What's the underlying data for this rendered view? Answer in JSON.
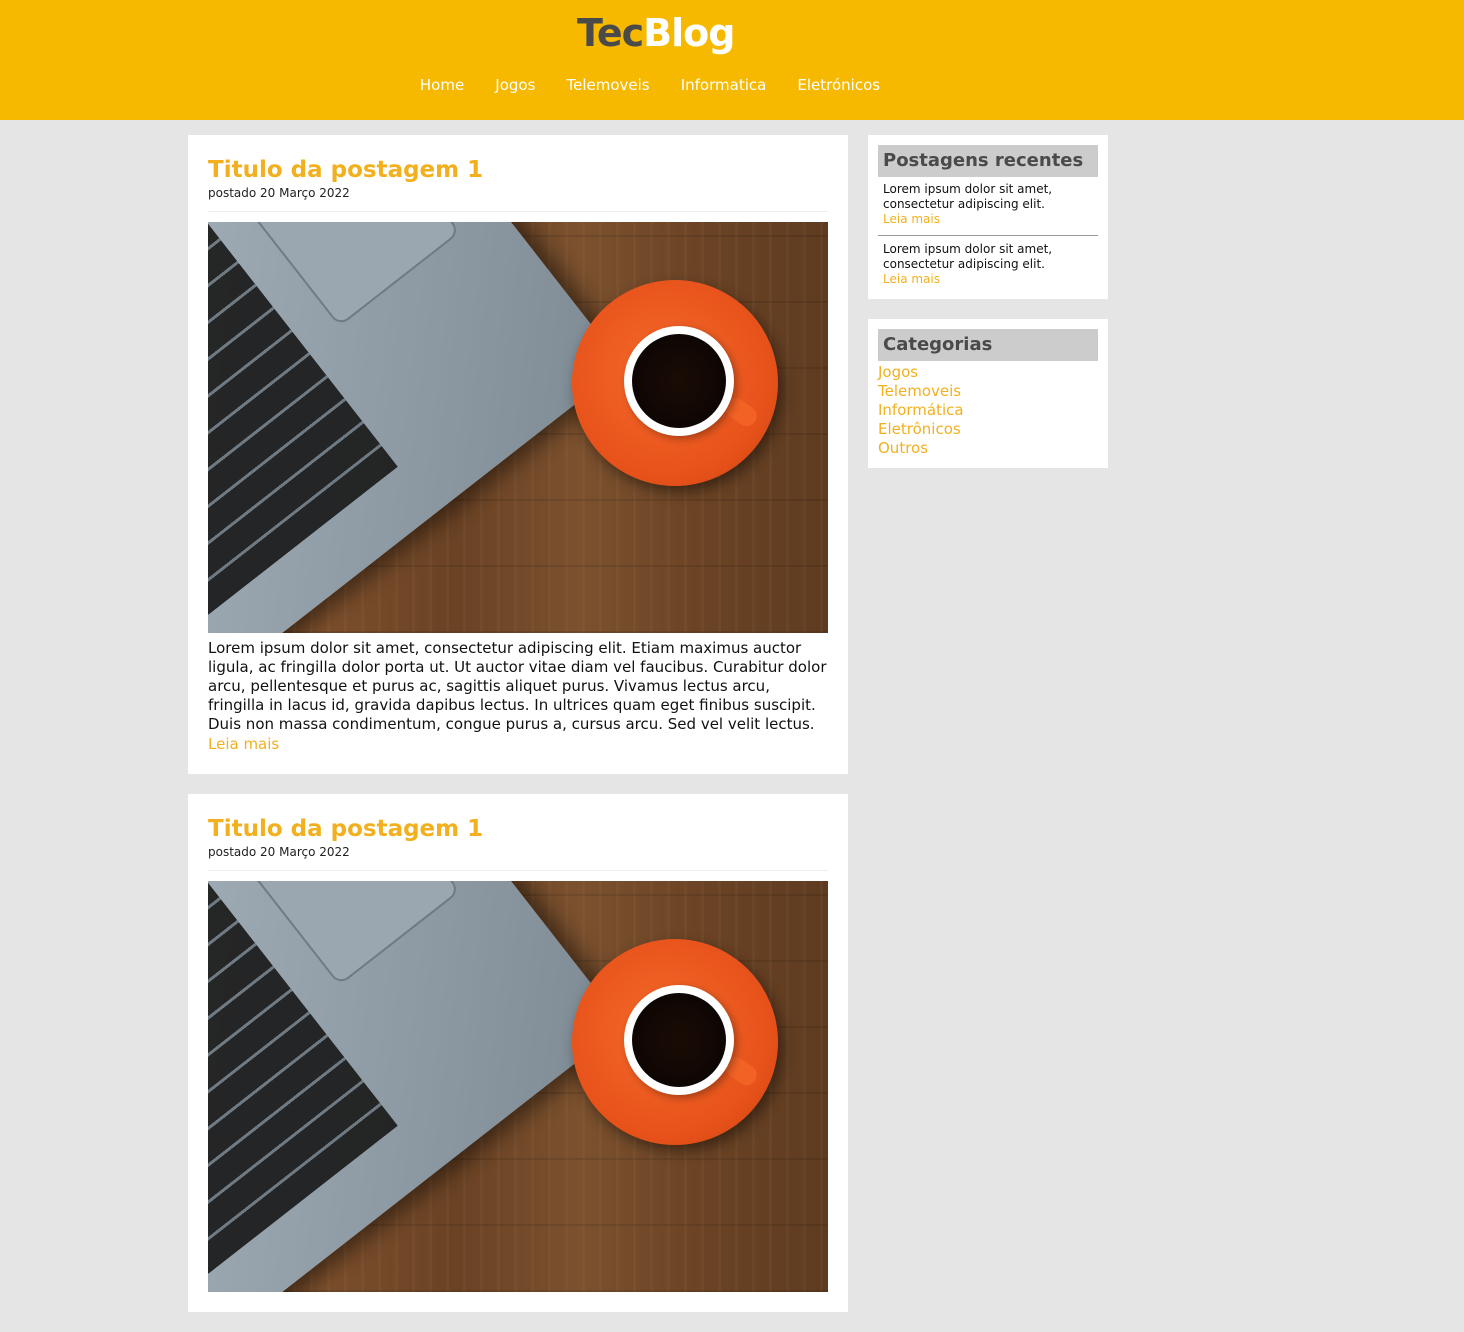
{
  "header": {
    "logo_part1": "Tec",
    "logo_part2": "Blog",
    "nav": [
      "Home",
      "Jogos",
      "Telemoveis",
      "Informatica",
      "Eletrónicos"
    ]
  },
  "posts": [
    {
      "title": "Titulo da postagem 1",
      "date": "postado 20 Março 2022",
      "image_icon": "laptop-coffee-photo",
      "body": "Lorem ipsum dolor sit amet, consectetur adipiscing elit. Etiam maximus auctor ligula, ac fringilla dolor porta ut. Ut auctor vitae diam vel faucibus. Curabitur dolor arcu, pellentesque et purus ac, sagittis aliquet purus. Vivamus lectus arcu, fringilla in lacus id, gravida dapibus lectus. In ultrices quam eget finibus suscipit. Duis non massa condimentum, congue purus a, cursus arcu. Sed vel velit lectus.",
      "more": "Leia mais"
    },
    {
      "title": "Titulo da postagem 1",
      "date": "postado 20 Março 2022",
      "image_icon": "laptop-coffee-photo"
    }
  ],
  "sidebar": {
    "recent_title": "Postagens recentes",
    "recent": [
      {
        "text": "Lorem ipsum dolor sit amet, consectetur adipiscing elit.",
        "more": "Leia mais"
      },
      {
        "text": "Lorem ipsum dolor sit amet, consectetur adipiscing elit.",
        "more": "Leia mais"
      }
    ],
    "categories_title": "Categorias",
    "categories": [
      "Jogos",
      "Telemoveis",
      "Informática",
      "Eletrônicos",
      "Outros"
    ]
  },
  "colors": {
    "header_bg": "#f7b900",
    "accent": "#f2b01e",
    "page_bg": "#e5e5e5"
  }
}
